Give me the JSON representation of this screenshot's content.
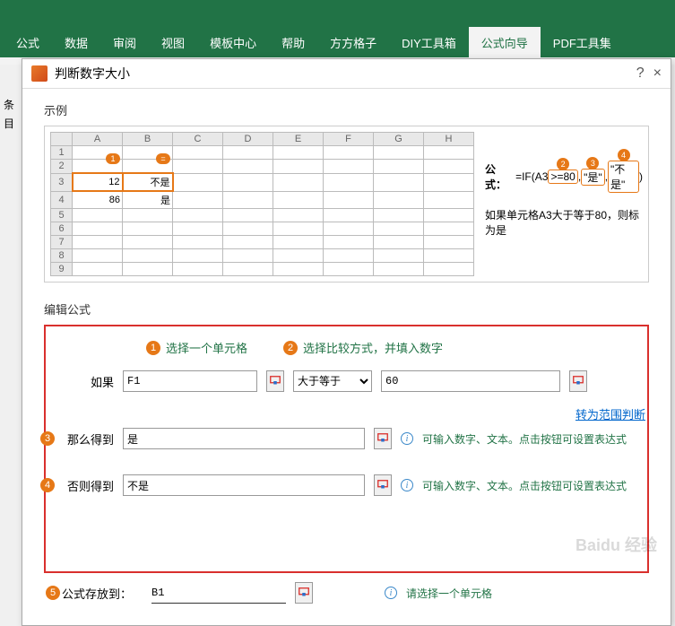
{
  "ribbon": {
    "tabs": [
      "公式",
      "数据",
      "审阅",
      "视图",
      "模板中心",
      "帮助",
      "方方格子",
      "DIY工具箱",
      "公式向导",
      "PDF工具集"
    ],
    "activeIndex": 8
  },
  "dialog": {
    "title": "判断数字大小",
    "help": "?",
    "close": "×"
  },
  "leftStrip": {
    "a": "条",
    "b": "目"
  },
  "example": {
    "sectionTitle": "示例",
    "cols": [
      "A",
      "B",
      "C",
      "D",
      "E",
      "F",
      "G",
      "H"
    ],
    "rows": [
      "1",
      "2",
      "3",
      "4",
      "5",
      "6",
      "7",
      "8",
      "9"
    ],
    "a3": "12",
    "b3": "不是",
    "a4": "86",
    "b4": "是",
    "formulaPrefix": "公式：",
    "formulaFunc": "=IF(A3",
    "hl1": ">=80",
    "comma1": ",",
    "hl2": "\"是\"",
    "comma2": ",",
    "hl3": "\"不是\"",
    "tail": ")",
    "desc": "如果单元格A3大于等于80，则标为是"
  },
  "edit": {
    "sectionTitle": "编辑公式",
    "guide1": "选择一个单元格",
    "guide2": "选择比较方式，并填入数字",
    "ifLabel": "如果",
    "cellValue": "F1",
    "operator": "大于等于",
    "threshold": "60",
    "rangeLink": "转为范围判断",
    "thenLabel": "那么得到",
    "thenValue": "是",
    "elseLabel": "否则得到",
    "elseValue": "不是",
    "hint": "可输入数字、文本。点击按钮可设置表达式",
    "saveLabel": "公式存放到：",
    "saveValue": "B1",
    "saveHint": "请选择一个单元格"
  },
  "badges": {
    "n1": "1",
    "n2": "2",
    "n3": "3",
    "n4": "4",
    "n5": "5"
  },
  "circles": {
    "c1": "1",
    "c2": "2",
    "c3": "3",
    "c4": "4",
    "c5": "5"
  },
  "watermark": "Baidu 经验"
}
